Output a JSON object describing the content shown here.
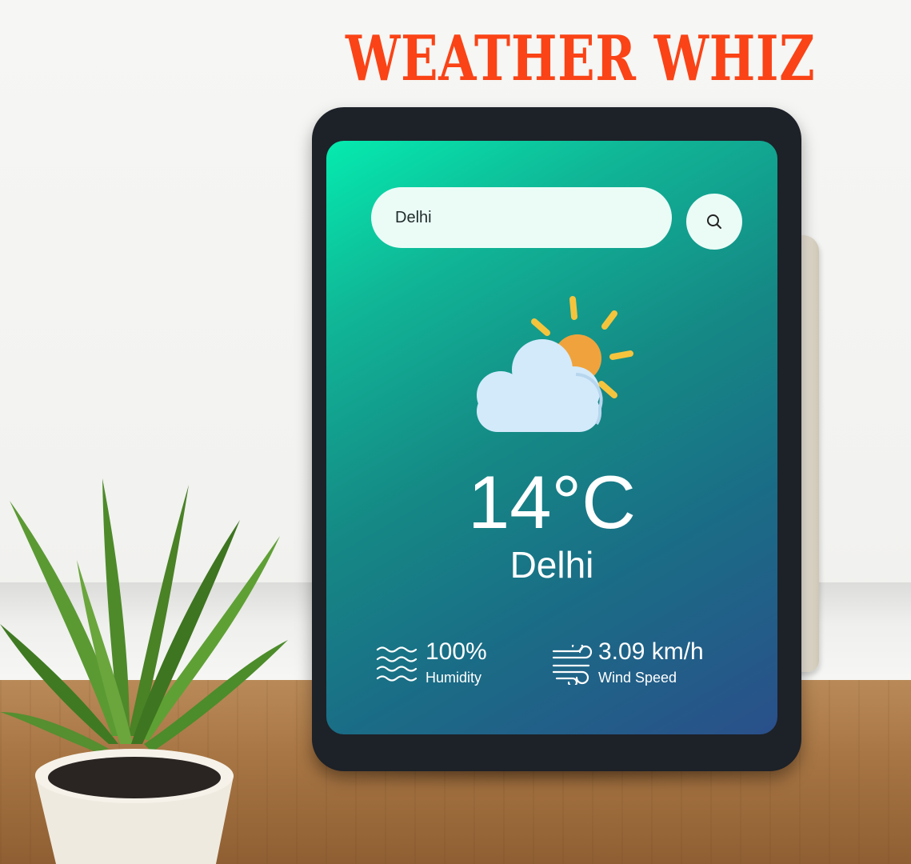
{
  "app": {
    "brand_title": "WEATHER WHIZ"
  },
  "search": {
    "value": "Delhi",
    "button_icon": "search-icon"
  },
  "weather": {
    "condition_icon": "partly-cloudy-icon",
    "temperature": "14°C",
    "city": "Delhi"
  },
  "stats": {
    "humidity": {
      "value": "100%",
      "label": "Humidity",
      "icon": "humidity-waves-icon"
    },
    "wind": {
      "value": "3.09 km/h",
      "label": "Wind Speed",
      "icon": "wind-icon"
    }
  },
  "colors": {
    "brand_title": "#fa4316",
    "screen_gradient_start": "#05ebaf",
    "screen_gradient_end": "#2a4f8a",
    "input_background": "#ebfcf7",
    "sun": "#f0a33c",
    "cloud": "#d3eafb"
  }
}
